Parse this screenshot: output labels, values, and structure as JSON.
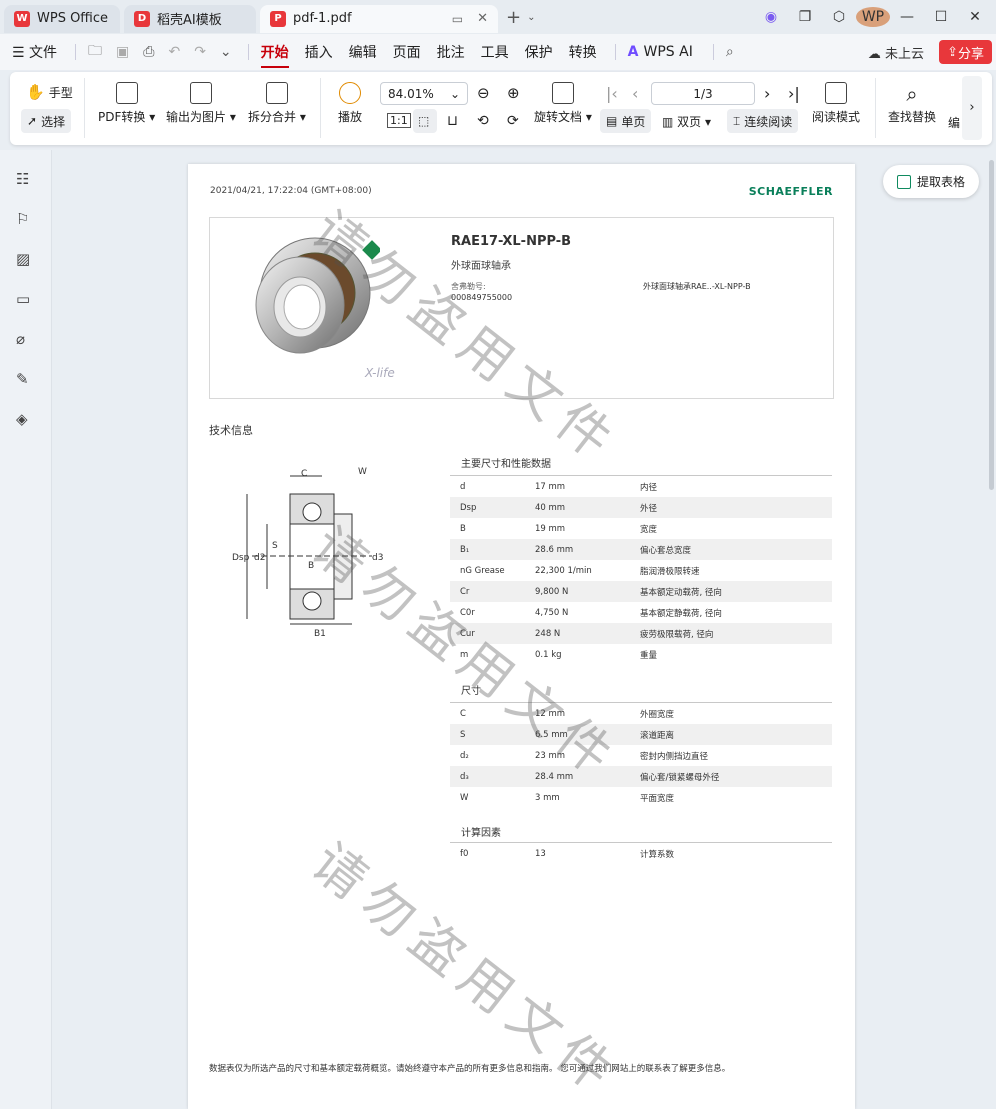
{
  "tabs": [
    {
      "label": "WPS Office",
      "logo": "W",
      "color": "#e8373b"
    },
    {
      "label": "稻壳AI模板",
      "logo": "D",
      "color": "#e8373b"
    },
    {
      "label": "pdf-1.pdf",
      "logo": "P",
      "color": "#e8373b"
    }
  ],
  "window": {
    "avatar": "WP"
  },
  "menu": {
    "file": "☰ 文件",
    "items": [
      "开始",
      "插入",
      "编辑",
      "页面",
      "批注",
      "工具",
      "保护",
      "转换"
    ],
    "active": "开始",
    "wps_ai": "WPS AI",
    "cloud": "未上云",
    "share": "分享"
  },
  "ribbon": {
    "hand": "手型",
    "select": "选择",
    "pdf_convert": "PDF转换",
    "export_image": "输出为图片",
    "split_merge": "拆分合并",
    "play": "播放",
    "zoom": "84.01%",
    "rotate": "旋转文档",
    "single_page": "单页",
    "double_page": "双页",
    "continuous": "连续阅读",
    "read_mode": "阅读模式",
    "page_indicator": "1/3",
    "find_replace": "查找替换",
    "edit": "编"
  },
  "extract_table": "提取表格",
  "doc": {
    "timestamp": "2021/04/21, 17:22:04 (GMT+08:00)",
    "brand": "SCHAEFFLER",
    "xlife": "X-life",
    "product_title": "RAE17-XL-NPP-B",
    "product_subtitle": "外球面球轴承",
    "label_no": "舍弗勒号:",
    "product_no": "000849755000",
    "right_desc": "外球面球轴承RAE..-XL-NPP-B",
    "tech_info": "技术信息",
    "section_main": "主要尺寸和性能数据",
    "main_rows": [
      [
        "d",
        "17 mm",
        "内径"
      ],
      [
        "Dsp",
        "40 mm",
        "外径"
      ],
      [
        "B",
        "19 mm",
        "宽度"
      ],
      [
        "B₁",
        "28.6 mm",
        "偏心套总宽度"
      ],
      [
        "nG Grease",
        "22,300 1/min",
        "脂润滑极限转速"
      ],
      [
        "Cr",
        "9,800 N",
        "基本额定动载荷, 径向"
      ],
      [
        "C0r",
        "4,750 N",
        "基本额定静载荷, 径向"
      ],
      [
        "Cur",
        "248 N",
        "疲劳极限载荷, 径向"
      ],
      [
        "m",
        "0.1 kg",
        "重量"
      ]
    ],
    "section_dims": "尺寸",
    "dim_rows": [
      [
        "C",
        "12 mm",
        "外圈宽度"
      ],
      [
        "S",
        "6.5 mm",
        "滚道距离"
      ],
      [
        "d₂",
        "23 mm",
        "密封内侧挡边直径"
      ],
      [
        "d₃",
        "28.4 mm",
        "偏心套/锁紧螺母外径"
      ],
      [
        "W",
        "3 mm",
        "平面宽度"
      ]
    ],
    "section_calc": "计算因素",
    "calc_rows": [
      [
        "f0",
        "13",
        "计算系数"
      ]
    ],
    "footer": "数据表仅为所选产品的尺寸和基本额定载荷概览。请始终遵守本产品的所有更多信息和指南。 您可通过我们网站上的联系表了解更多信息。",
    "watermark": "请勿盗用文件",
    "diagram_labels": {
      "c": "C",
      "w": "W",
      "s": "S",
      "b": "B",
      "b1": "B1",
      "dsp": "Dsp",
      "d2": "d2",
      "d3": "d3"
    }
  }
}
